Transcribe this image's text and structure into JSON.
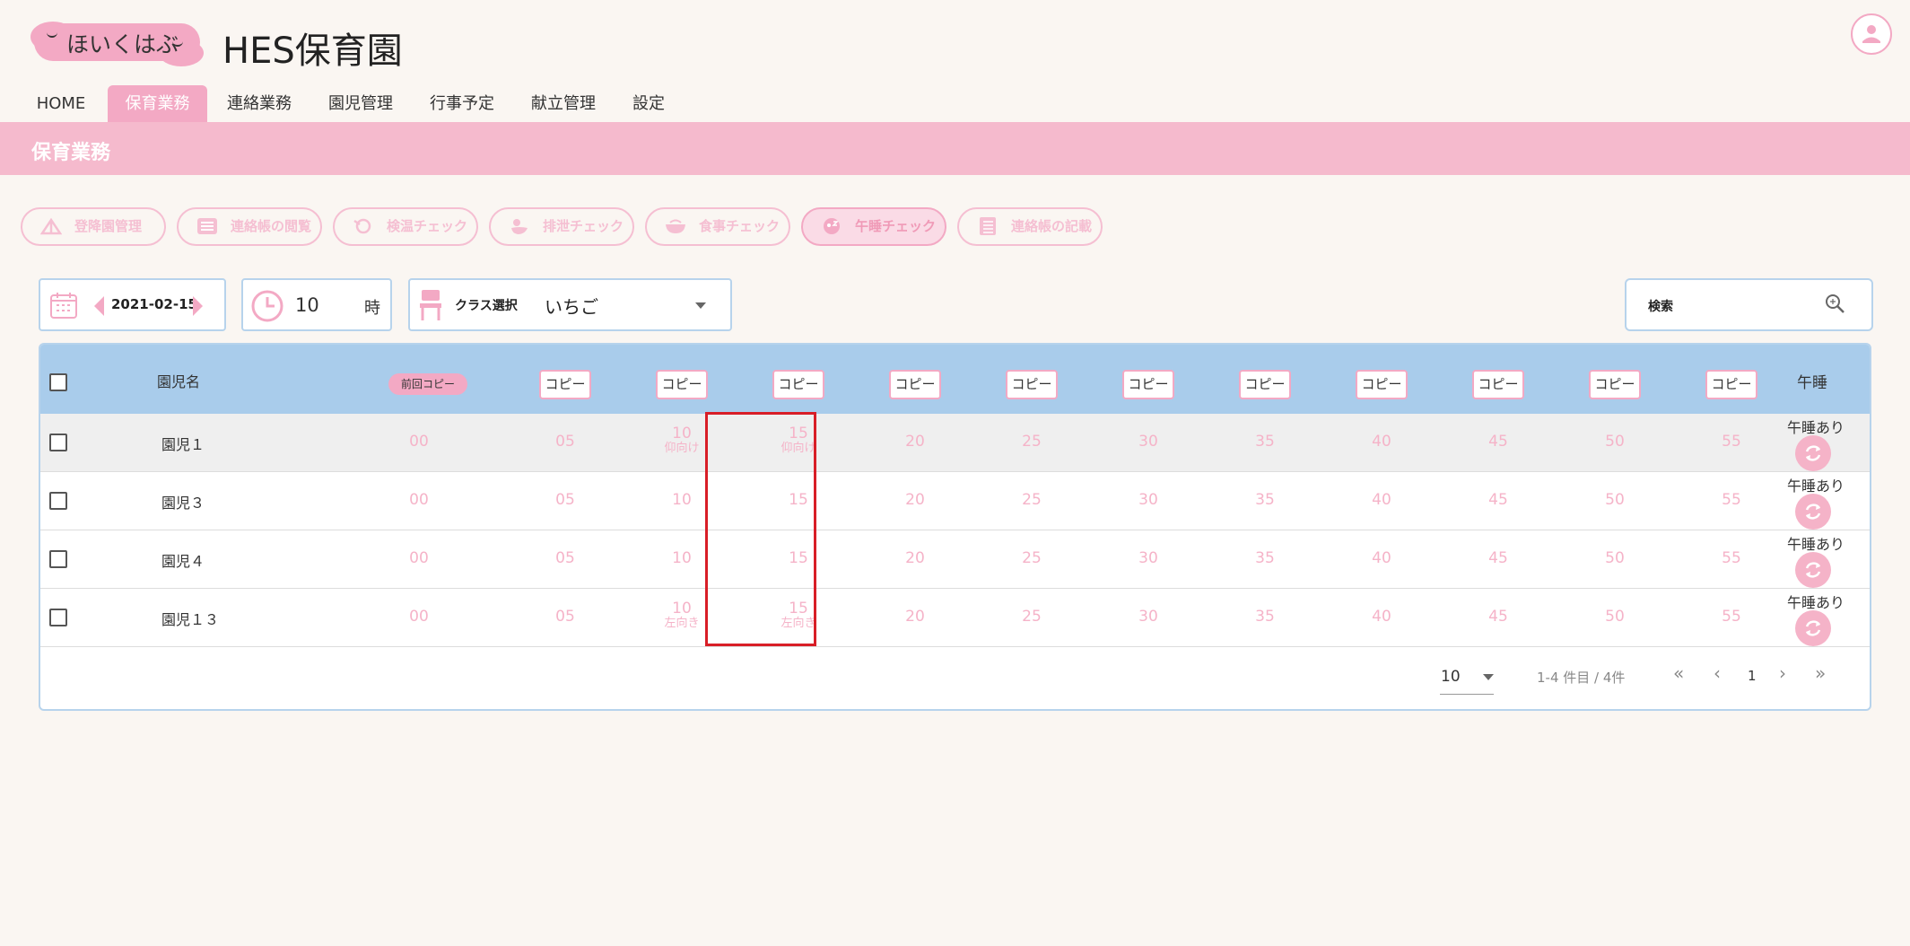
{
  "header": {
    "logo_text": "ほいくはぶ",
    "app_title": "HES保育園"
  },
  "nav": {
    "items": [
      {
        "label": "HOME"
      },
      {
        "label": "保育業務"
      },
      {
        "label": "連絡業務"
      },
      {
        "label": "園児管理"
      },
      {
        "label": "行事予定"
      },
      {
        "label": "献立管理"
      },
      {
        "label": "設定"
      }
    ],
    "active": "保育業務"
  },
  "page_title": "保育業務",
  "toolbar": {
    "buttons": [
      {
        "label": "登降園管理",
        "icon": "tent-icon"
      },
      {
        "label": "連絡帳の閲覧",
        "icon": "list-icon"
      },
      {
        "label": "検温チェック",
        "icon": "thermometer-icon"
      },
      {
        "label": "排泄チェック",
        "icon": "duck-icon"
      },
      {
        "label": "食事チェック",
        "icon": "bowl-icon"
      },
      {
        "label": "午睡チェック",
        "icon": "sleep-icon"
      },
      {
        "label": "連絡帳の記載",
        "icon": "notebook-icon"
      }
    ],
    "active": "午睡チェック"
  },
  "filters": {
    "date": "2021-02-15",
    "hour_value": "10",
    "hour_unit": "時",
    "class_label": "クラス選択",
    "class_value": "いちご",
    "search_label": "検索"
  },
  "table": {
    "header_name": "園児名",
    "prev_copy_label": "前回コピー",
    "copy_label": "コピー",
    "header_nap": "午睡",
    "minutes": [
      "00",
      "05",
      "10",
      "15",
      "20",
      "25",
      "30",
      "35",
      "40",
      "45",
      "50",
      "55"
    ],
    "rows": [
      {
        "name": "園児１",
        "nap": "午睡あり",
        "notes": {
          "10": "仰向け",
          "15": "仰向け"
        }
      },
      {
        "name": "園児３",
        "nap": "午睡あり",
        "notes": {}
      },
      {
        "name": "園児４",
        "nap": "午睡あり",
        "notes": {}
      },
      {
        "name": "園児１３",
        "nap": "午睡あり",
        "notes": {
          "10": "左向き",
          "15": "左向き"
        }
      }
    ]
  },
  "pagination": {
    "per_page": "10",
    "range_text": "1-4 件目 / 4件",
    "page": "1"
  },
  "colors": {
    "accent_pink": "#f3a9c4",
    "header_blue": "#a9cceb",
    "highlight_red": "#d81e27"
  }
}
